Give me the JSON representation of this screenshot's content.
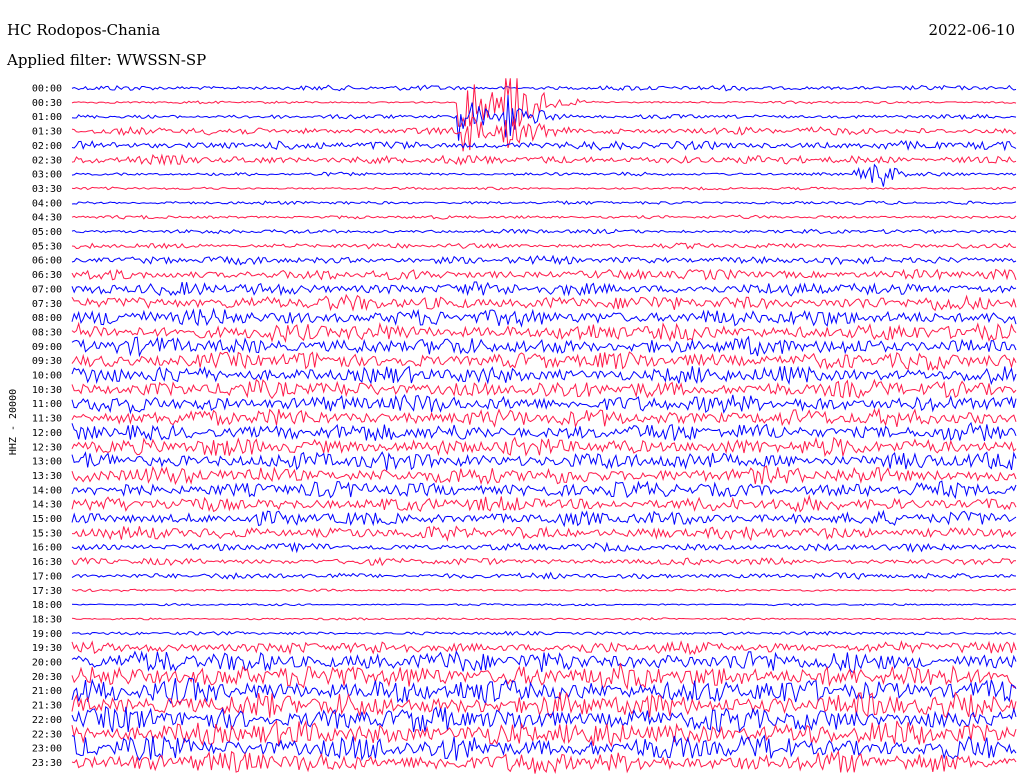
{
  "header": {
    "station": "HC Rodopos-Chania",
    "filter": "Applied filter: WWSSN-SP",
    "date": "2022-06-10"
  },
  "chart_data": {
    "type": "line",
    "title": "HC Rodopos-Chania",
    "subtitle": "Applied filter: WWSSN-SP",
    "date": "2022-06-10",
    "ylabel": "HHZ - 20000",
    "xlabel": "",
    "row_labels": [
      "00:00",
      "00:30",
      "01:00",
      "01:30",
      "02:00",
      "02:30",
      "03:00",
      "03:30",
      "04:00",
      "04:30",
      "05:00",
      "05:30",
      "06:00",
      "06:30",
      "07:00",
      "07:30",
      "08:00",
      "08:30",
      "09:00",
      "09:30",
      "10:00",
      "10:30",
      "11:00",
      "11:30",
      "12:00",
      "12:30",
      "13:00",
      "13:30",
      "14:00",
      "14:30",
      "15:00",
      "15:30",
      "16:00",
      "16:30",
      "17:00",
      "17:30",
      "18:00",
      "18:30",
      "19:00",
      "19:30",
      "20:00",
      "20:30",
      "21:00",
      "21:30",
      "22:00",
      "22:30",
      "23:00",
      "23:30"
    ],
    "trace_colors": [
      "#0000ff",
      "#ff1a4a"
    ],
    "activity": [
      0.3,
      0.15,
      0.25,
      0.45,
      0.5,
      0.5,
      0.2,
      0.15,
      0.2,
      0.2,
      0.25,
      0.3,
      0.45,
      0.6,
      0.75,
      0.85,
      0.95,
      1.0,
      1.0,
      1.0,
      1.0,
      1.0,
      1.0,
      1.0,
      1.0,
      1.0,
      1.0,
      1.0,
      0.9,
      0.85,
      0.8,
      0.75,
      0.45,
      0.4,
      0.35,
      0.15,
      0.12,
      0.12,
      0.2,
      0.7,
      1.2,
      1.4,
      1.4,
      1.4,
      1.4,
      1.4,
      1.4,
      1.2
    ],
    "events": [
      {
        "time": "00:30",
        "type": "earthquake"
      },
      {
        "time": "00:30",
        "type": "earthquake"
      },
      {
        "time": "03:00",
        "type": "earthquake"
      }
    ]
  }
}
